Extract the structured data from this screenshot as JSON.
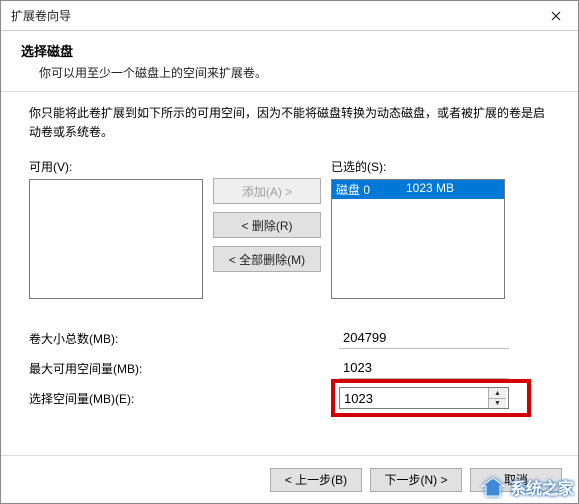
{
  "window": {
    "title": "扩展卷向导"
  },
  "header": {
    "h1": "选择磁盘",
    "sub": "你可以用至少一个磁盘上的空间来扩展卷。"
  },
  "description": "你只能将此卷扩展到如下所示的可用空间，因为不能将磁盘转换为动态磁盘，或者被扩展的卷是启动卷或系统卷。",
  "available": {
    "label": "可用(V):"
  },
  "selected": {
    "label": "已选的(S):",
    "items": [
      {
        "disk": "磁盘 0",
        "size": "1023 MB"
      }
    ]
  },
  "buttons": {
    "add": "添加(A) >",
    "remove": "< 删除(R)",
    "removeAll": "< 全部删除(M)"
  },
  "fields": {
    "totalLabel": "卷大小总数(MB):",
    "totalValue": "204799",
    "maxLabel": "最大可用空间量(MB):",
    "maxValue": "1023",
    "selectLabel": "选择空间量(MB)(E):",
    "selectValue": "1023"
  },
  "footer": {
    "back": "< 上一步(B)",
    "next": "下一步(N) >",
    "cancel": "取消"
  },
  "watermark": "系统之家"
}
